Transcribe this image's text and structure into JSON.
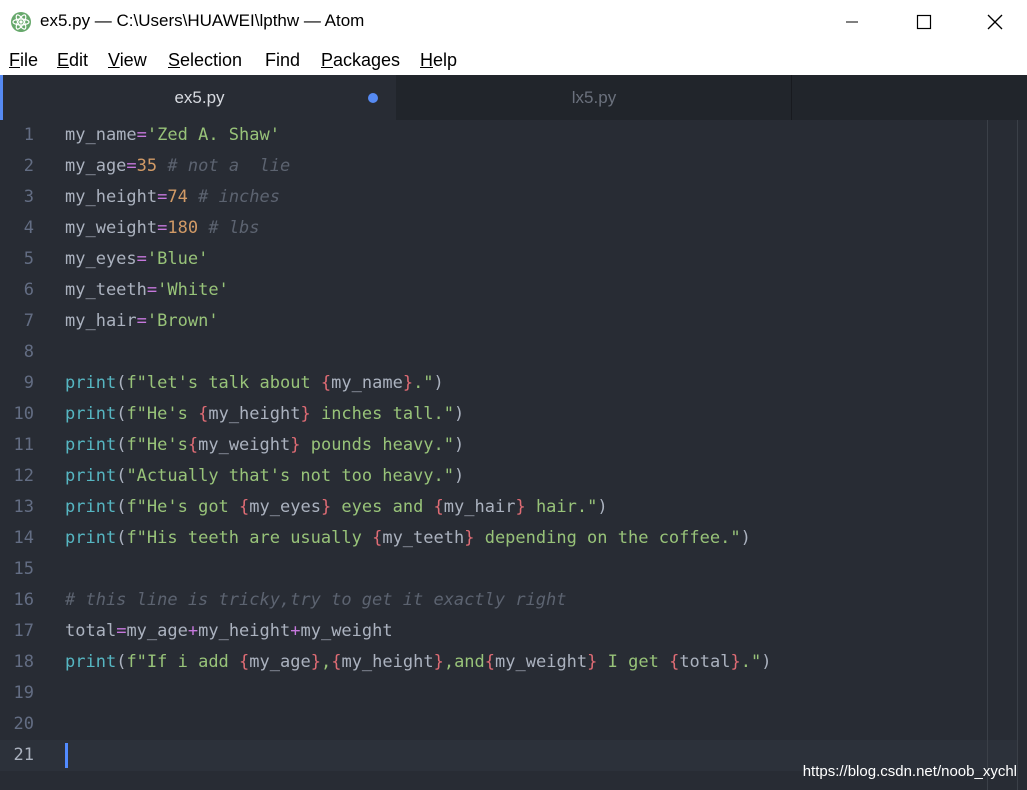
{
  "window": {
    "title": "ex5.py — C:\\Users\\HUAWEI\\lpthw — Atom",
    "minimize_label": "—",
    "maximize_label": "☐",
    "close_label": "✕"
  },
  "menu": [
    {
      "label": "File",
      "key": "F",
      "rest": "ile"
    },
    {
      "label": "Edit",
      "key": "E",
      "rest": "dit"
    },
    {
      "label": "View",
      "key": "V",
      "rest": "iew"
    },
    {
      "label": "Selection",
      "key": "S",
      "rest": "election"
    },
    {
      "label": "Find",
      "key": "",
      "rest": "Find"
    },
    {
      "label": "Packages",
      "key": "P",
      "rest": "ackages"
    },
    {
      "label": "Help",
      "key": "H",
      "rest": "elp"
    }
  ],
  "tabs": [
    {
      "label": "ex5.py",
      "active": true,
      "modified": true
    },
    {
      "label": "lx5.py",
      "active": false,
      "modified": false
    }
  ],
  "editor": {
    "cursor_line": 21,
    "lines": [
      {
        "num": "1",
        "tokens": [
          [
            "v",
            "my_name"
          ],
          [
            "o",
            "="
          ],
          [
            "s",
            "'Zed A. Shaw'"
          ]
        ]
      },
      {
        "num": "2",
        "tokens": [
          [
            "v",
            "my_age"
          ],
          [
            "o",
            "="
          ],
          [
            "n",
            "35"
          ],
          [
            "p",
            " "
          ],
          [
            "c",
            "# not a  lie"
          ]
        ]
      },
      {
        "num": "3",
        "tokens": [
          [
            "v",
            "my_height"
          ],
          [
            "o",
            "="
          ],
          [
            "n",
            "74"
          ],
          [
            "p",
            " "
          ],
          [
            "c",
            "# inches"
          ]
        ]
      },
      {
        "num": "4",
        "tokens": [
          [
            "v",
            "my_weight"
          ],
          [
            "o",
            "="
          ],
          [
            "n",
            "180"
          ],
          [
            "p",
            " "
          ],
          [
            "c",
            "# lbs"
          ]
        ]
      },
      {
        "num": "5",
        "tokens": [
          [
            "v",
            "my_eyes"
          ],
          [
            "o",
            "="
          ],
          [
            "s",
            "'Blue'"
          ]
        ]
      },
      {
        "num": "6",
        "tokens": [
          [
            "v",
            "my_teeth"
          ],
          [
            "o",
            "="
          ],
          [
            "s",
            "'White'"
          ]
        ]
      },
      {
        "num": "7",
        "tokens": [
          [
            "v",
            "my_hair"
          ],
          [
            "o",
            "="
          ],
          [
            "s",
            "'Brown'"
          ]
        ]
      },
      {
        "num": "8",
        "tokens": []
      },
      {
        "num": "9",
        "tokens": [
          [
            "f",
            "print"
          ],
          [
            "p",
            "("
          ],
          [
            "s",
            "f\"let's talk about "
          ],
          [
            "b",
            "{"
          ],
          [
            "v",
            "my_name"
          ],
          [
            "b",
            "}"
          ],
          [
            "s",
            ".\""
          ],
          [
            "p",
            ")"
          ]
        ]
      },
      {
        "num": "10",
        "tokens": [
          [
            "f",
            "print"
          ],
          [
            "p",
            "("
          ],
          [
            "s",
            "f\"He's "
          ],
          [
            "b",
            "{"
          ],
          [
            "v",
            "my_height"
          ],
          [
            "b",
            "}"
          ],
          [
            "s",
            " inches tall.\""
          ],
          [
            "p",
            ")"
          ]
        ]
      },
      {
        "num": "11",
        "tokens": [
          [
            "f",
            "print"
          ],
          [
            "p",
            "("
          ],
          [
            "s",
            "f\"He's"
          ],
          [
            "b",
            "{"
          ],
          [
            "v",
            "my_weight"
          ],
          [
            "b",
            "}"
          ],
          [
            "s",
            " pounds heavy.\""
          ],
          [
            "p",
            ")"
          ]
        ]
      },
      {
        "num": "12",
        "tokens": [
          [
            "f",
            "print"
          ],
          [
            "p",
            "("
          ],
          [
            "s",
            "\"Actually that's not too heavy.\""
          ],
          [
            "p",
            ")"
          ]
        ]
      },
      {
        "num": "13",
        "tokens": [
          [
            "f",
            "print"
          ],
          [
            "p",
            "("
          ],
          [
            "s",
            "f\"He's got "
          ],
          [
            "b",
            "{"
          ],
          [
            "v",
            "my_eyes"
          ],
          [
            "b",
            "}"
          ],
          [
            "s",
            " eyes and "
          ],
          [
            "b",
            "{"
          ],
          [
            "v",
            "my_hair"
          ],
          [
            "b",
            "}"
          ],
          [
            "s",
            " hair.\""
          ],
          [
            "p",
            ")"
          ]
        ]
      },
      {
        "num": "14",
        "tokens": [
          [
            "f",
            "print"
          ],
          [
            "p",
            "("
          ],
          [
            "s",
            "f\"His teeth are usually "
          ],
          [
            "b",
            "{"
          ],
          [
            "v",
            "my_teeth"
          ],
          [
            "b",
            "}"
          ],
          [
            "s",
            " depending on the coffee.\""
          ],
          [
            "p",
            ")"
          ]
        ]
      },
      {
        "num": "15",
        "tokens": []
      },
      {
        "num": "16",
        "tokens": [
          [
            "c",
            "# this line is tricky,try to get it exactly right"
          ]
        ]
      },
      {
        "num": "17",
        "tokens": [
          [
            "v",
            "total"
          ],
          [
            "o",
            "="
          ],
          [
            "v",
            "my_age"
          ],
          [
            "o",
            "+"
          ],
          [
            "v",
            "my_height"
          ],
          [
            "o",
            "+"
          ],
          [
            "v",
            "my_weight"
          ]
        ]
      },
      {
        "num": "18",
        "tokens": [
          [
            "f",
            "print"
          ],
          [
            "p",
            "("
          ],
          [
            "s",
            "f\"If i add "
          ],
          [
            "b",
            "{"
          ],
          [
            "v",
            "my_age"
          ],
          [
            "b",
            "}"
          ],
          [
            "s",
            ","
          ],
          [
            "b",
            "{"
          ],
          [
            "v",
            "my_height"
          ],
          [
            "b",
            "}"
          ],
          [
            "s",
            ",and"
          ],
          [
            "b",
            "{"
          ],
          [
            "v",
            "my_weight"
          ],
          [
            "b",
            "}"
          ],
          [
            "s",
            " I get "
          ],
          [
            "b",
            "{"
          ],
          [
            "v",
            "total"
          ],
          [
            "b",
            "}"
          ],
          [
            "s",
            ".\""
          ],
          [
            "p",
            ")"
          ]
        ]
      },
      {
        "num": "19",
        "tokens": []
      },
      {
        "num": "20",
        "tokens": []
      },
      {
        "num": "21",
        "tokens": []
      }
    ]
  },
  "watermark": "https://blog.csdn.net/noob_xychl"
}
